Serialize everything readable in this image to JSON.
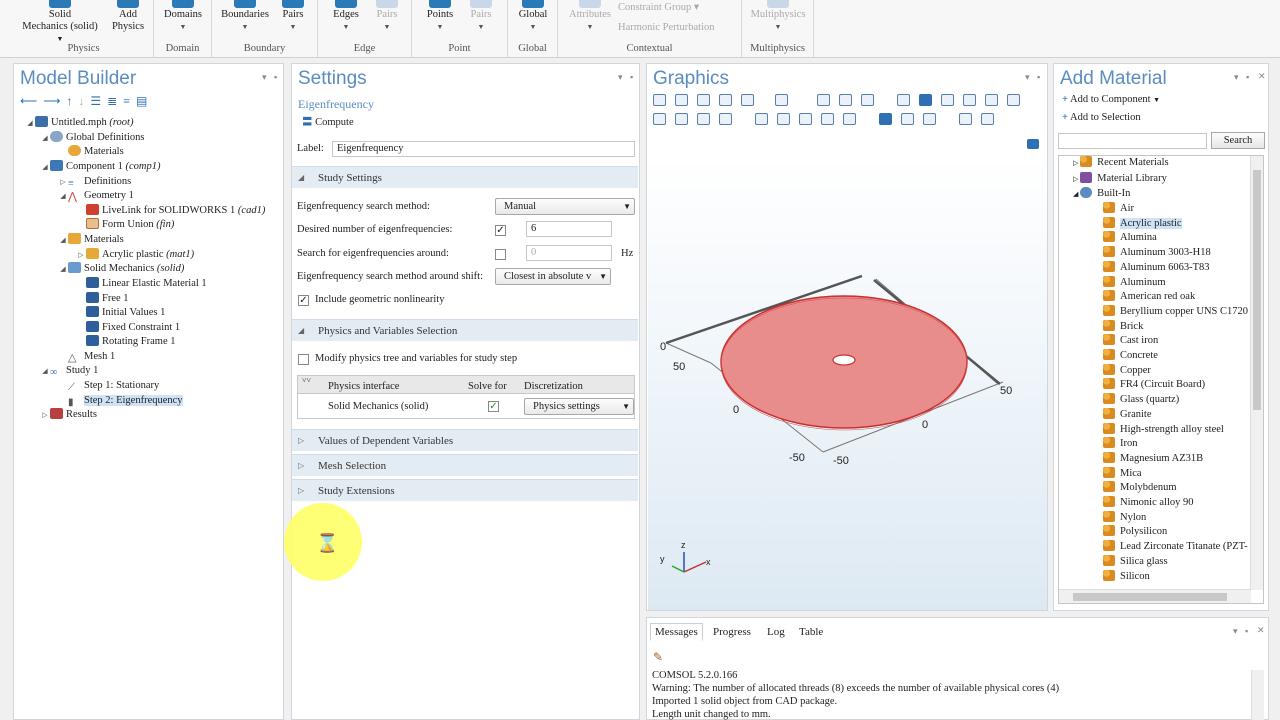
{
  "ribbon": {
    "groups": [
      {
        "label": "Physics",
        "buttons": [
          "Solid Mechanics (solid)",
          "Add Physics"
        ]
      },
      {
        "label": "Domain",
        "buttons": [
          "Domains"
        ]
      },
      {
        "label": "Boundary",
        "buttons": [
          "Boundaries",
          "Pairs"
        ]
      },
      {
        "label": "Edge",
        "buttons": [
          "Edges",
          "Pairs"
        ]
      },
      {
        "label": "Point",
        "buttons": [
          "Points",
          "Pairs"
        ]
      },
      {
        "label": "Global",
        "buttons": [
          "Global"
        ]
      },
      {
        "label": "Contextual",
        "buttons": [
          "Attributes",
          "Constraint Group",
          "Harmonic Perturbation"
        ]
      },
      {
        "label": "Multiphysics",
        "buttons": [
          "Multiphysics"
        ]
      }
    ],
    "solid_line1": "Solid",
    "solid_line2": "Mechanics (solid)",
    "add_line1": "Add",
    "add_line2": "Physics"
  },
  "model_builder": {
    "title": "Model Builder",
    "tree": [
      {
        "label": "Untitled.mph",
        "tag": "(root)"
      },
      {
        "label": "Global Definitions",
        "tag": ""
      },
      {
        "label": "Materials",
        "tag": ""
      },
      {
        "label": "Component 1",
        "tag": "(comp1)"
      },
      {
        "label": "Definitions",
        "tag": ""
      },
      {
        "label": "Geometry 1",
        "tag": ""
      },
      {
        "label": "LiveLink for SOLIDWORKS 1",
        "tag": "(cad1)"
      },
      {
        "label": "Form Union",
        "tag": "(fin)"
      },
      {
        "label": "Materials",
        "tag": ""
      },
      {
        "label": "Acrylic plastic",
        "tag": "(mat1)"
      },
      {
        "label": "Solid Mechanics",
        "tag": "(solid)"
      },
      {
        "label": "Linear Elastic Material 1",
        "tag": ""
      },
      {
        "label": "Free 1",
        "tag": ""
      },
      {
        "label": "Initial Values 1",
        "tag": ""
      },
      {
        "label": "Fixed Constraint 1",
        "tag": ""
      },
      {
        "label": "Rotating Frame 1",
        "tag": ""
      },
      {
        "label": "Mesh 1",
        "tag": ""
      },
      {
        "label": "Study 1",
        "tag": ""
      },
      {
        "label": "Step 1: Stationary",
        "tag": ""
      },
      {
        "label": "Step 2: Eigenfrequency",
        "tag": ""
      },
      {
        "label": "Results",
        "tag": ""
      }
    ]
  },
  "settings": {
    "title": "Settings",
    "subtitle": "Eigenfrequency",
    "compute": "Compute",
    "label_caption": "Label:",
    "label_value": "Eigenfrequency",
    "study_settings": "Study Settings",
    "search_method_label": "Eigenfrequency search method:",
    "search_method_value": "Manual",
    "desired_label": "Desired number of eigenfrequencies:",
    "desired_value": "6",
    "search_around_label": "Search for eigenfrequencies around:",
    "search_around_value": "0",
    "search_around_unit": "Hz",
    "shift_label": "Eigenfrequency search method around shift:",
    "shift_value": "Closest in absolute v",
    "nonlinearity_label": "Include geometric nonlinearity",
    "physics_sel": "Physics and Variables Selection",
    "modify_label": "Modify physics tree and variables for study step",
    "table_headers": [
      "Physics interface",
      "Solve for",
      "Discretization"
    ],
    "table_row": {
      "iface": "Solid Mechanics (solid)",
      "disc": "Physics settings"
    },
    "sections": [
      "Values of Dependent Variables",
      "Mesh Selection",
      "Study Extensions"
    ]
  },
  "graphics": {
    "title": "Graphics",
    "axis_labels": [
      "50",
      "0",
      "50",
      "0",
      "-50",
      "-50",
      "0"
    ],
    "triad": [
      "z",
      "y",
      "x"
    ]
  },
  "add_material": {
    "title": "Add Material",
    "add_to_component": "Add to Component",
    "add_to_selection": "Add to Selection",
    "search_button": "Search",
    "folders": [
      "Recent Materials",
      "Material Library",
      "Built-In"
    ],
    "items": [
      "Air",
      "Acrylic plastic",
      "Alumina",
      "Aluminum 3003-H18",
      "Aluminum 6063-T83",
      "Aluminum",
      "American red oak",
      "Beryllium copper UNS C1720",
      "Brick",
      "Cast iron",
      "Concrete",
      "Copper",
      "FR4 (Circuit Board)",
      "Glass (quartz)",
      "Granite",
      "High-strength alloy steel",
      "Iron",
      "Magnesium AZ31B",
      "Mica",
      "Molybdenum",
      "Nimonic alloy 90",
      "Nylon",
      "Polysilicon",
      "Lead Zirconate Titanate (PZT-",
      "Silica glass",
      "Silicon"
    ],
    "selected": "Acrylic plastic"
  },
  "messages": {
    "tabs": [
      "Messages",
      "Progress",
      "Log",
      "Table"
    ],
    "lines": [
      "COMSOL 5.2.0.166",
      "Warning: The number of allocated threads (8) exceeds the number of available physical cores (4)",
      "Imported 1 solid object from CAD package.",
      "Length unit changed to mm."
    ]
  },
  "colors": {
    "accent": "#5a8cc0",
    "disk": "#e88a8a",
    "disk_edge": "#c83030",
    "cursor": "#ffff60"
  }
}
